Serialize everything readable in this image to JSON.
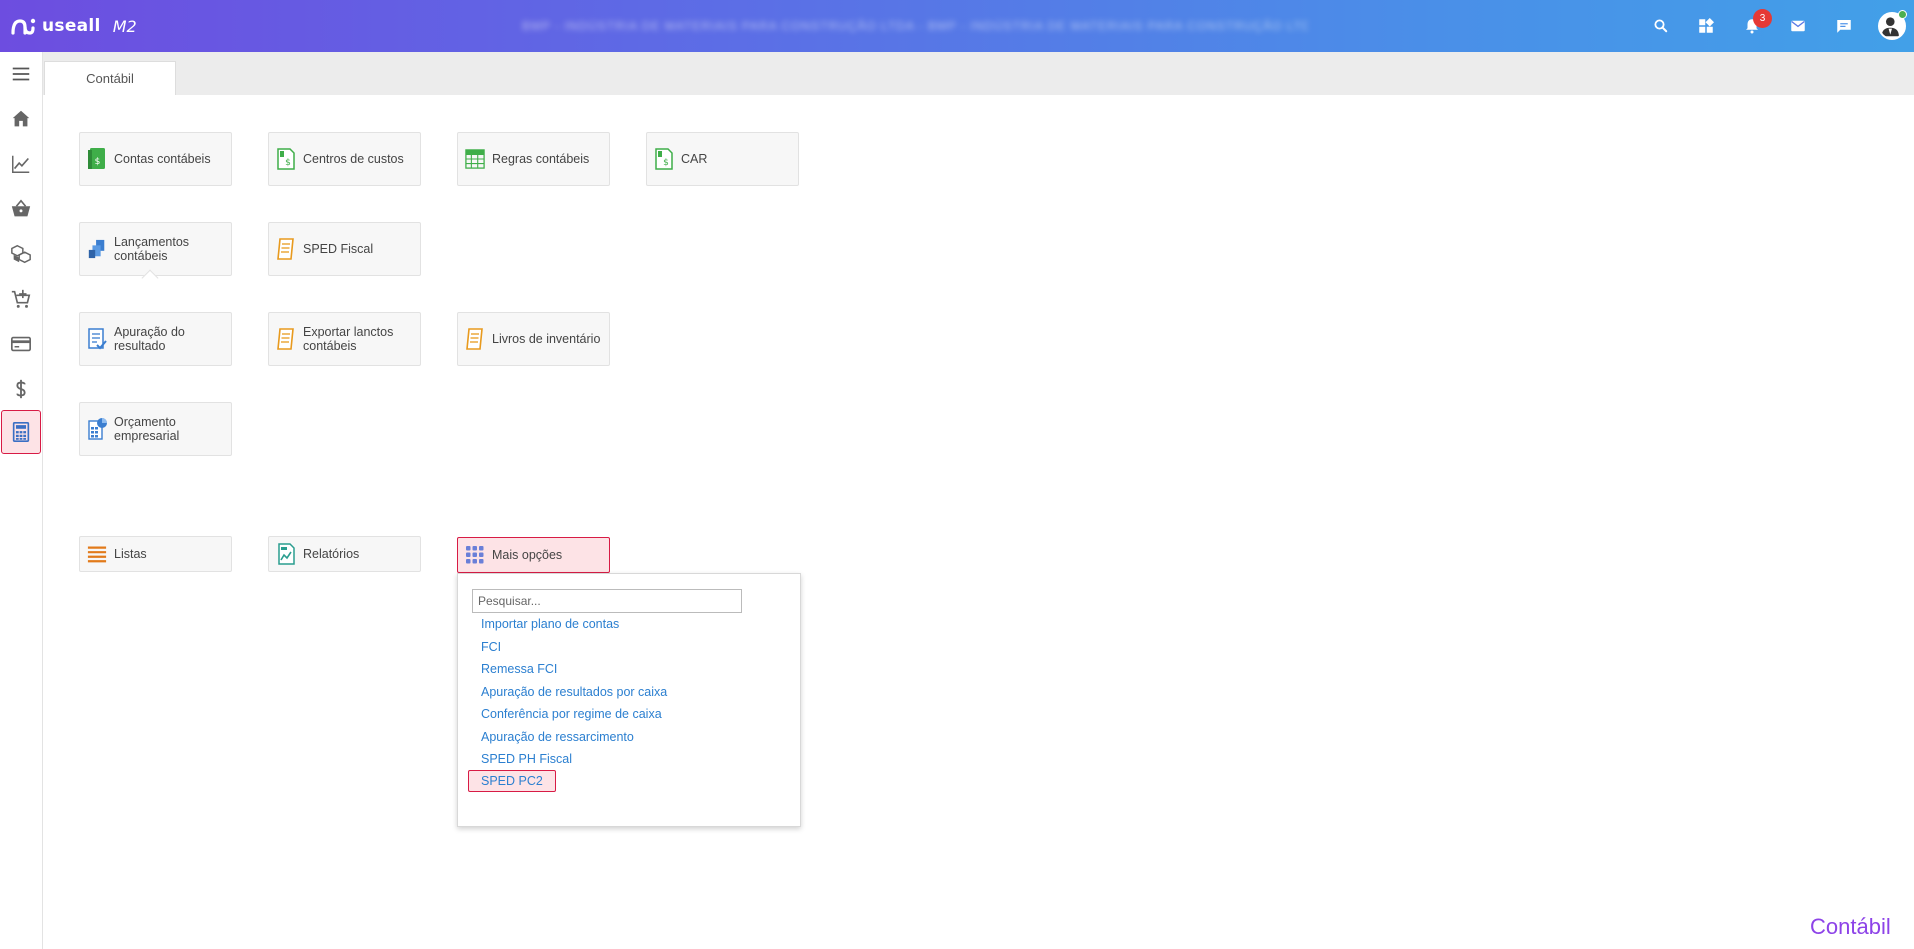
{
  "app": {
    "logo_text": "useall",
    "logo_suffix": "M2",
    "company_name": "BMP - INDÚSTRIA DE MATERIAIS PARA CONSTRUÇÃO LTDA - BMP - INDÚSTRIA DE MATERIAIS PARA CONSTRUÇÃO LTDA",
    "notification_count": "3",
    "accent_color": "#d81b45",
    "gradient_start": "#6d4de0",
    "gradient_end": "#42a0e8"
  },
  "header_icons": [
    "search-icon",
    "apps-grid-icon",
    "bell-icon",
    "mail-icon",
    "chat-icon",
    "user-avatar"
  ],
  "sidebar": {
    "items": [
      {
        "name": "menu-icon"
      },
      {
        "name": "home-icon"
      },
      {
        "name": "chart-line-icon"
      },
      {
        "name": "basket-icon"
      },
      {
        "name": "boxes-icon"
      },
      {
        "name": "cart-add-icon"
      },
      {
        "name": "credit-card-icon"
      },
      {
        "name": "dollar-icon"
      },
      {
        "name": "calculator-icon",
        "active": true
      }
    ]
  },
  "tabs": [
    {
      "label": "Contábil"
    }
  ],
  "cards": {
    "contas_contabeis": "Contas contábeis",
    "centros_de_custos": "Centros de custos",
    "regras_contabeis": "Regras contábeis",
    "car": "CAR",
    "lancamentos_contabeis": "Lançamentos contábeis",
    "sped_fiscal": "SPED Fiscal",
    "apuracao_resultado": "Apuração do resultado",
    "exportar_lanctos": "Exportar lanctos contábeis",
    "livros_inventario": "Livros de inventário",
    "orcamento_empresarial": "Orçamento empresarial"
  },
  "bottom_bar": {
    "listas": "Listas",
    "relatorios": "Relatórios",
    "mais_opcoes": "Mais opções"
  },
  "dropdown": {
    "search_placeholder": "Pesquisar...",
    "items": [
      "Importar plano de contas",
      "FCI",
      "Remessa FCI",
      "Apuração de resultados por caixa",
      "Conferência por regime de caixa",
      "Apuração de ressarcimento",
      "SPED PH Fiscal",
      "SPED PC2"
    ]
  },
  "footer": {
    "module_title": "Contábil"
  }
}
